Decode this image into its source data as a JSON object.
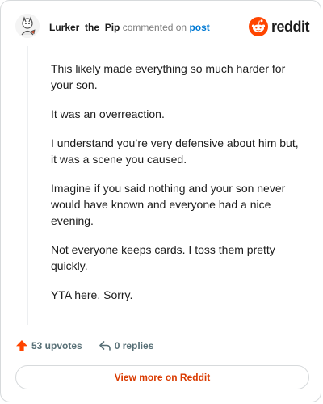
{
  "header": {
    "username": "Lurker_the_Pip",
    "action_text": "commented on",
    "post_link_text": "post",
    "brand_name": "reddit"
  },
  "comment": {
    "paragraphs": [
      "This likely made everything so much harder for your son.",
      "It was an overreaction.",
      "I understand you’re very defensive about him but, it was a scene you caused.",
      "Imagine if you said nothing and your son never would have known and everyone had a nice evening.",
      "Not everyone keeps cards. I toss them pretty quickly.",
      "YTA here. Sorry."
    ]
  },
  "actions": {
    "upvotes": "53 upvotes",
    "replies": "0 replies"
  },
  "footer": {
    "view_more_label": "View more on Reddit"
  },
  "colors": {
    "brand_orange": "#ff4500",
    "link_blue": "#0079d3",
    "view_more_text": "#d93a00"
  },
  "icons": [
    "avatar",
    "reddit-logo-icon",
    "upvote-arrow-icon",
    "reply-icon"
  ]
}
